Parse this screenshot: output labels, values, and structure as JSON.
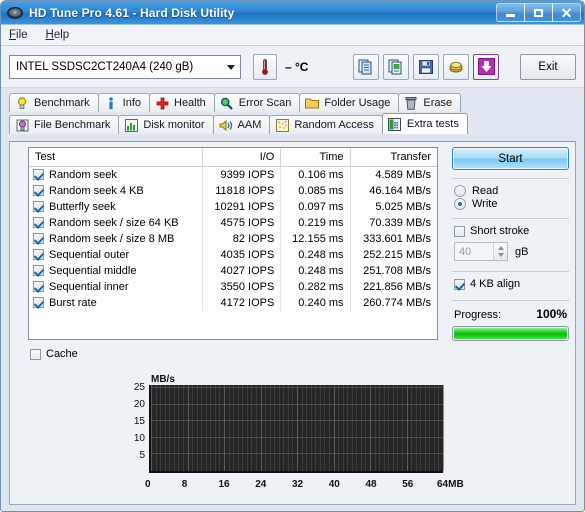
{
  "window": {
    "title": "HD Tune Pro 4.61 - Hard Disk Utility",
    "icon": "hard-disk-icon",
    "controls": {
      "minimize": "—",
      "maximize": "□",
      "close": "✕"
    }
  },
  "menu": {
    "items": [
      {
        "label": "File",
        "accel": "F"
      },
      {
        "label": "Help",
        "accel": "H"
      }
    ]
  },
  "toolbar": {
    "drive": "INTEL SSDSC2CT240A4 (240 gB)",
    "temperature": "– °C",
    "thermometer_icon": "thermometer-icon",
    "buttons": [
      {
        "name": "copy-icon",
        "label": "Copy"
      },
      {
        "name": "copy-image-icon",
        "label": "Copy image"
      },
      {
        "name": "save-icon",
        "label": "Save"
      },
      {
        "name": "gold-icon",
        "label": "Register"
      },
      {
        "name": "download-arrow-icon",
        "label": "Download"
      }
    ],
    "exit_label": "Exit"
  },
  "tabs_row1": [
    {
      "label": "Benchmark",
      "icon": "lightbulb-icon",
      "active": false
    },
    {
      "label": "Info",
      "icon": "info-icon",
      "active": false
    },
    {
      "label": "Health",
      "icon": "health-cross-icon",
      "active": false
    },
    {
      "label": "Error Scan",
      "icon": "magnifier-icon",
      "active": false
    },
    {
      "label": "Folder Usage",
      "icon": "folder-icon",
      "active": false
    },
    {
      "label": "Erase",
      "icon": "trash-icon",
      "active": false
    }
  ],
  "tabs_row2": [
    {
      "label": "File Benchmark",
      "icon": "file-benchmark-icon",
      "active": false
    },
    {
      "label": "Disk monitor",
      "icon": "bar-chart-icon",
      "active": false
    },
    {
      "label": "AAM",
      "icon": "speaker-icon",
      "active": false
    },
    {
      "label": "Random Access",
      "icon": "random-access-icon",
      "active": false
    },
    {
      "label": "Extra tests",
      "icon": "extra-tests-icon",
      "active": true
    }
  ],
  "results": {
    "columns": [
      "Test",
      "I/O",
      "Time",
      "Transfer"
    ],
    "rows": [
      {
        "checked": true,
        "test": "Random seek",
        "io": "9399 IOPS",
        "time": "0.106 ms",
        "transfer": "4.589 MB/s"
      },
      {
        "checked": true,
        "test": "Random seek 4 KB",
        "io": "11818 IOPS",
        "time": "0.085 ms",
        "transfer": "46.164 MB/s"
      },
      {
        "checked": true,
        "test": "Butterfly seek",
        "io": "10291 IOPS",
        "time": "0.097 ms",
        "transfer": "5.025 MB/s"
      },
      {
        "checked": true,
        "test": "Random seek / size 64 KB",
        "io": "4575 IOPS",
        "time": "0.219 ms",
        "transfer": "70.339 MB/s"
      },
      {
        "checked": true,
        "test": "Random seek / size 8 MB",
        "io": "82 IOPS",
        "time": "12.155 ms",
        "transfer": "333.601 MB/s"
      },
      {
        "checked": true,
        "test": "Sequential outer",
        "io": "4035 IOPS",
        "time": "0.248 ms",
        "transfer": "252.215 MB/s"
      },
      {
        "checked": true,
        "test": "Sequential middle",
        "io": "4027 IOPS",
        "time": "0.248 ms",
        "transfer": "251.708 MB/s"
      },
      {
        "checked": true,
        "test": "Sequential inner",
        "io": "3550 IOPS",
        "time": "0.282 ms",
        "transfer": "221.856 MB/s"
      },
      {
        "checked": true,
        "test": "Burst rate",
        "io": "4172 IOPS",
        "time": "0.240 ms",
        "transfer": "260.774 MB/s"
      }
    ],
    "cache_label": "Cache",
    "cache_checked": false
  },
  "panel": {
    "start_label": "Start",
    "mode_read": "Read",
    "mode_write": "Write",
    "mode_selected": "Write",
    "short_stroke_label": "Short stroke",
    "short_stroke_checked": false,
    "short_stroke_value": "40",
    "short_stroke_unit": "gB",
    "align_label": "4 KB align",
    "align_checked": true,
    "progress_label": "Progress:",
    "progress_value": "100%",
    "progress_percent": 100,
    "progress_color": "#1ecb1e"
  },
  "chart_data": {
    "type": "area",
    "title": "",
    "xlabel": "64MB",
    "ylabel": "MB/s",
    "unit_label": "MB/s",
    "yticks": [
      5,
      10,
      15,
      20,
      25
    ],
    "xticks": [
      0,
      8,
      16,
      24,
      32,
      40,
      48,
      56,
      64
    ],
    "xtick_labels": [
      "0",
      "8",
      "16",
      "24",
      "32",
      "40",
      "48",
      "56",
      "64MB"
    ],
    "xlim": [
      0,
      64
    ],
    "ylim": [
      0,
      26
    ],
    "grid": true,
    "legend": "none",
    "background": "#262626",
    "x": [
      0,
      8,
      16,
      24,
      32,
      40,
      48,
      56,
      64
    ],
    "values": [
      26,
      26,
      26,
      26,
      26,
      26,
      26,
      26,
      26
    ]
  }
}
